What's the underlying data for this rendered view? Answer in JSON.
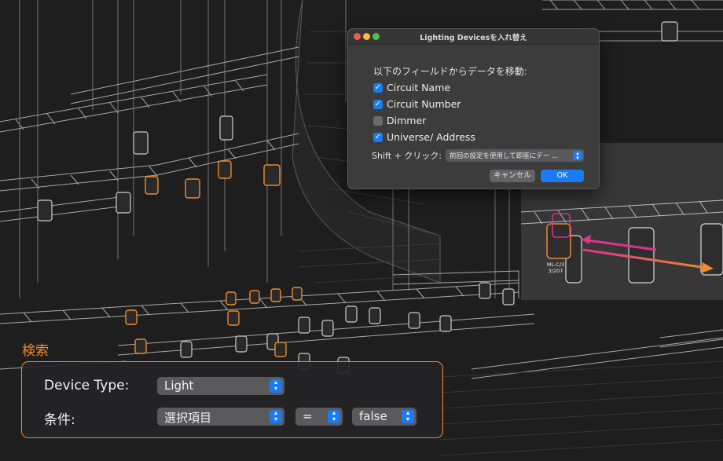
{
  "dialog": {
    "title": "Lighting Devicesを入れ替え",
    "prompt": "以下のフィールドからデータを移動:",
    "options": [
      {
        "label": "Circuit Name",
        "checked": true
      },
      {
        "label": "Circuit Number",
        "checked": true
      },
      {
        "label": "Dimmer",
        "checked": false
      },
      {
        "label": "Universe/ Address",
        "checked": true
      }
    ],
    "checkmark": "✓",
    "shift_label": "Shift + クリック:",
    "shift_value": "前回の設定を使用して即座にデー ...",
    "cancel_label": "キャンセル",
    "ok_label": "OK"
  },
  "inset": {
    "label_line1": "ML-C/3",
    "label_line2": "3/207"
  },
  "search": {
    "title": "検索",
    "device_type_label": "Device Type:",
    "device_type_value": "Light",
    "condition_label": "条件:",
    "condition_field": "選択項目",
    "condition_operator": "=",
    "condition_value": "false"
  },
  "colors": {
    "accent_blue": "#1a7cf0",
    "highlight_orange": "#e98d37",
    "highlight_magenta": "#e0328e",
    "background": "#1f1e1f"
  }
}
